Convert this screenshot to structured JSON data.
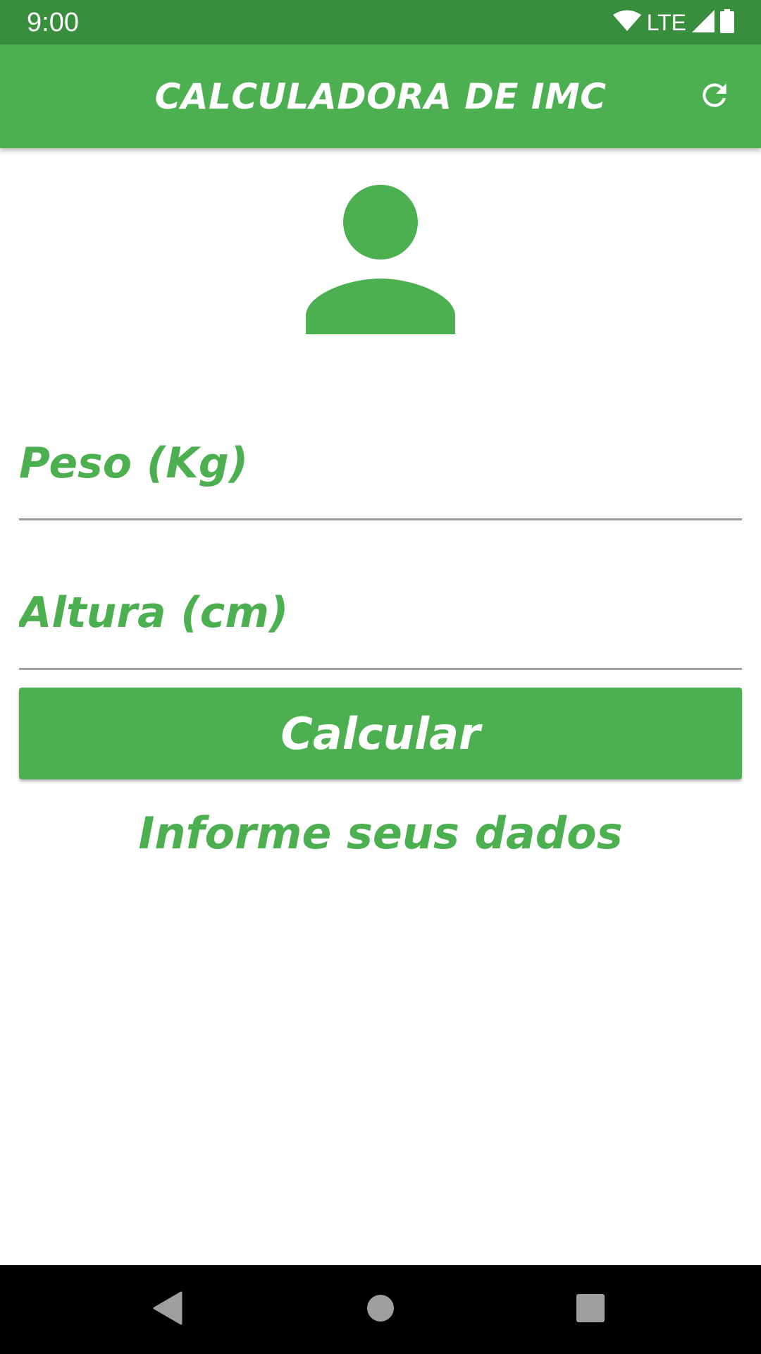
{
  "status_bar": {
    "time": "9:00",
    "network": "LTE",
    "icons": [
      "wifi-icon",
      "signal-icon",
      "battery-icon"
    ]
  },
  "app_bar": {
    "title": "CALCULADORA DE IMC",
    "action_icon": "refresh-icon"
  },
  "avatar": {
    "icon": "person-icon"
  },
  "form": {
    "weight_placeholder": "Peso (Kg)",
    "weight_value": "",
    "height_placeholder": "Altura (cm)",
    "height_value": "",
    "calculate_label": "Calcular"
  },
  "result": {
    "message": "Informe seus dados"
  },
  "navigation": {
    "buttons": [
      "back-icon",
      "home-icon",
      "recents-icon"
    ]
  },
  "colors": {
    "primary": "#4caf50",
    "primary_dark": "#388e3c",
    "divider": "#9e9e9e",
    "nav_button": "#9e9e9e"
  }
}
